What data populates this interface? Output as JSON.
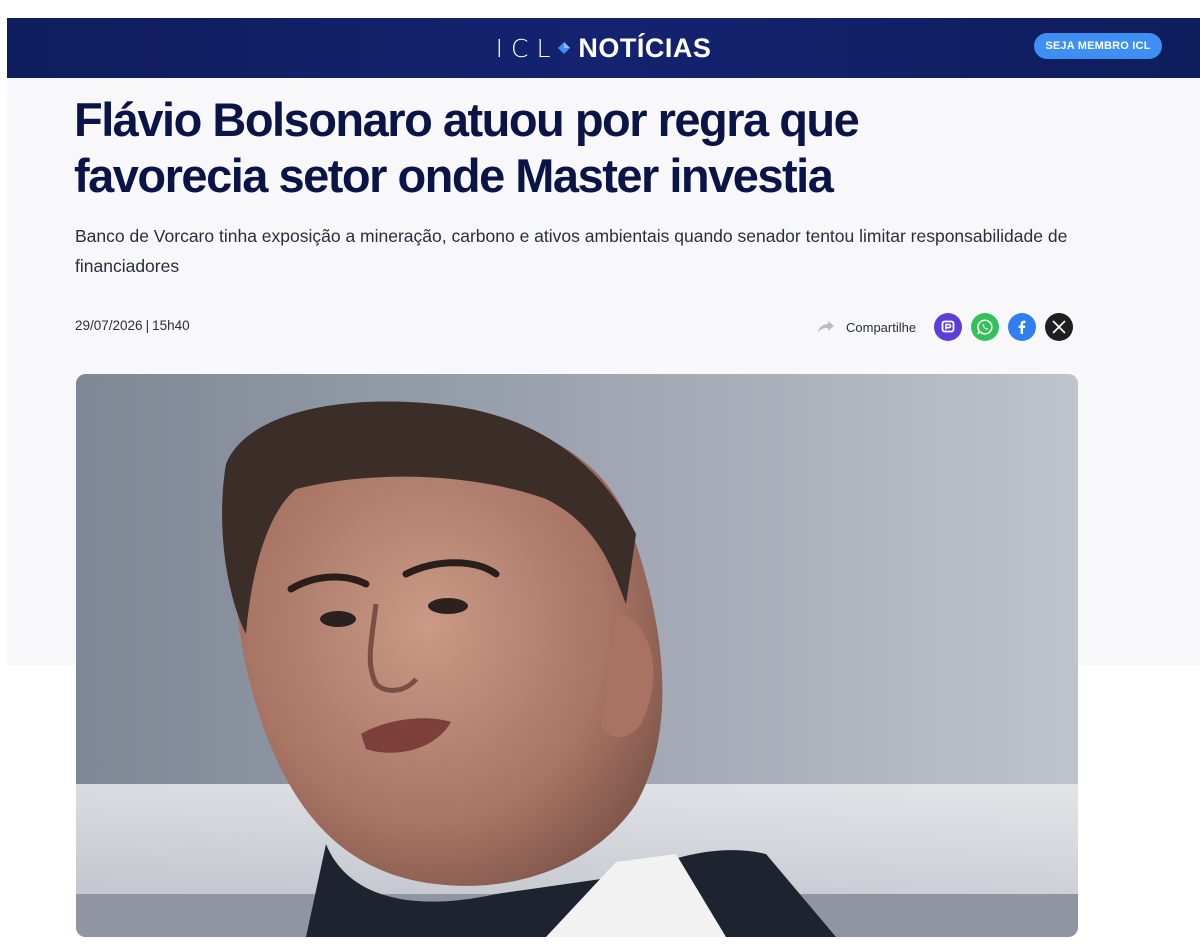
{
  "header": {
    "logo_icl": "ICL",
    "logo_noticias": "NOTÍCIAS",
    "member_button": "SEJA MEMBRO ICL"
  },
  "article": {
    "headline": "Flávio Bolsonaro atuou por regra que favorecia setor onde Master investia",
    "subtitle": "Banco de Vorcaro tinha exposição a mineração, carbono e ativos ambientais quando senador tentou limitar responsabilidade de financiadores",
    "date": "29/07/2026",
    "separator": "|",
    "time": "15h40"
  },
  "share": {
    "label": "Compartilhe",
    "buttons": [
      {
        "name": "pix-share-button",
        "icon": "pix-icon",
        "color": "#5b3fd6"
      },
      {
        "name": "whatsapp-share-button",
        "icon": "whatsapp-icon",
        "color": "#34c05b"
      },
      {
        "name": "facebook-share-button",
        "icon": "facebook-icon",
        "color": "#2f7ff0"
      },
      {
        "name": "x-share-button",
        "icon": "x-icon",
        "color": "#1f1f1f"
      }
    ]
  },
  "colors": {
    "header_bg": "#0e1d5c",
    "member_button_bg": "#3e8ff2",
    "headline": "#0b1446"
  }
}
